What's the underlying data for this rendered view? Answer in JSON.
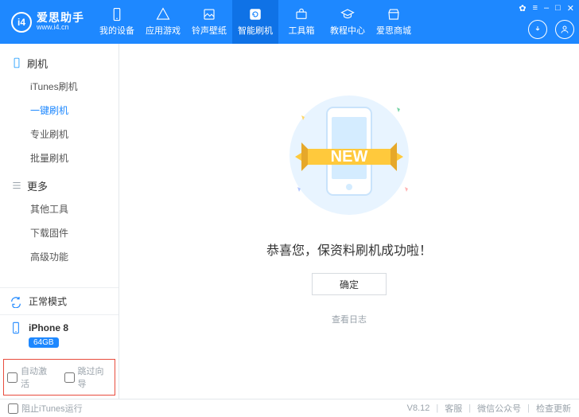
{
  "brand": {
    "name": "爱思助手",
    "url": "www.i4.cn",
    "logo_text": "i4"
  },
  "header": {
    "tabs": [
      {
        "label": "我的设备"
      },
      {
        "label": "应用游戏"
      },
      {
        "label": "铃声壁纸"
      },
      {
        "label": "智能刷机",
        "active": true
      },
      {
        "label": "工具箱"
      },
      {
        "label": "教程中心"
      },
      {
        "label": "爱思商城"
      }
    ],
    "win": {
      "skin": "✿",
      "menu": "≡",
      "min": "–",
      "max": "□",
      "close": "✕"
    }
  },
  "sidebar": {
    "groups": [
      {
        "title": "刷机",
        "items": [
          "iTunes刷机",
          "一键刷机",
          "专业刷机",
          "批量刷机"
        ],
        "active_index": 1
      },
      {
        "title": "更多",
        "items": [
          "其他工具",
          "下载固件",
          "高级功能"
        ]
      }
    ],
    "mode": "正常模式",
    "device": {
      "name": "iPhone 8",
      "badge": "64GB"
    },
    "checks": {
      "auto_activate": "自动激活",
      "skip_guide": "跳过向导"
    }
  },
  "main": {
    "message": "恭喜您，保资料刷机成功啦！",
    "ok_label": "确定",
    "log_label": "查看日志",
    "new_badge": "NEW"
  },
  "footer": {
    "block_itunes": "阻止iTunes运行",
    "version": "V8.12",
    "links": [
      "客服",
      "微信公众号",
      "检查更新"
    ]
  }
}
